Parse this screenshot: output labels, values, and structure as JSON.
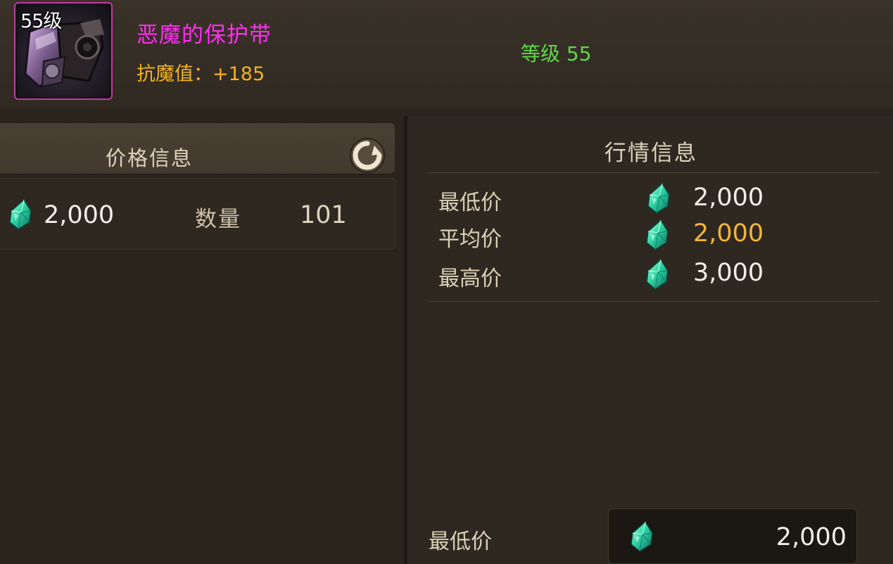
{
  "item": {
    "level_badge": "55级",
    "name": "恶魔的保护带",
    "stat": "抗魔值：+185",
    "required_level": "等级 55"
  },
  "price_info": {
    "title": "价格信息",
    "price": "2,000",
    "quantity_label": "数量",
    "quantity_value": "101"
  },
  "market_info": {
    "title": "行情信息",
    "rows": [
      {
        "label": "最低价",
        "value": "2,000"
      },
      {
        "label": "平均价",
        "value": "2,000"
      },
      {
        "label": "最高价",
        "value": "3,000"
      }
    ]
  },
  "bottom": {
    "label": "最低价",
    "value": "2,000"
  },
  "colors": {
    "item_name": "#ff2ef2",
    "stat": "#f5b31c",
    "level": "#5fd84a",
    "average_price": "#f2b63c",
    "frame_border": "#c53aa8"
  },
  "icons": {
    "currency": "green-gem-icon",
    "refresh": "refresh-icon"
  }
}
